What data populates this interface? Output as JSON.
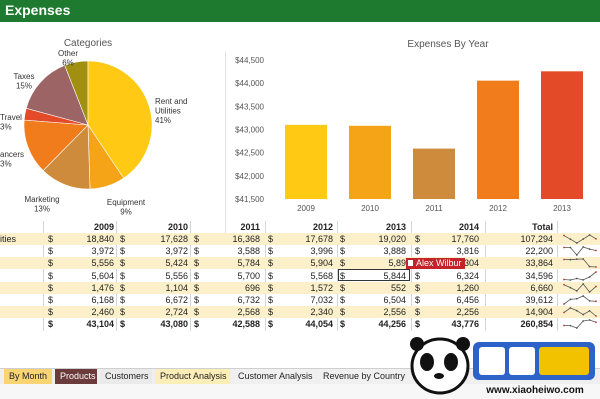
{
  "window": {
    "title": "Expenses"
  },
  "chart_data": [
    {
      "type": "pie",
      "title": "Categories",
      "slices": [
        {
          "label": "Other",
          "value": 6,
          "color": "#a08f10"
        },
        {
          "label": "Rent and Utilities",
          "value": 41,
          "color": "#ffc914"
        },
        {
          "label": "Equipment",
          "value": 9,
          "color": "#f5a418"
        },
        {
          "label": "Marketing",
          "value": 13,
          "color": "#cf8b3c"
        },
        {
          "label": "Freelancers",
          "value": 14,
          "color": "#f07c1c"
        },
        {
          "label": "Travel",
          "value": 3,
          "color": "#e34b28"
        },
        {
          "label": "Taxes",
          "value": 15,
          "color": "#9c6464"
        }
      ],
      "labels_text": {
        "other": [
          "Other",
          "6%"
        ],
        "rent": [
          "Rent and",
          "Utilities",
          "41%"
        ],
        "equipment": [
          "Equipment",
          "9%"
        ],
        "marketing": [
          "Marketing",
          "13%"
        ],
        "freelancers": [
          "ancers",
          "3%"
        ],
        "travel": [
          "Travel",
          "3%"
        ],
        "taxes": [
          "Taxes",
          "15%"
        ]
      }
    },
    {
      "type": "bar",
      "title": "Expenses By Year",
      "categories": [
        "2009",
        "2010",
        "2011",
        "2012",
        "2013"
      ],
      "values": [
        43100,
        43080,
        42588,
        44054,
        44256
      ],
      "colors": [
        "#ffc914",
        "#f5a418",
        "#cf8b3c",
        "#f07c1c",
        "#e34b28"
      ],
      "ylim": [
        41500,
        44500
      ],
      "yticks": [
        "$44,500",
        "$44,000",
        "$43,500",
        "$43,000",
        "$42,500",
        "$42,000",
        "$41,500"
      ],
      "ytick_values": [
        44500,
        44000,
        43500,
        43000,
        42500,
        42000,
        41500
      ],
      "grid": false
    }
  ],
  "table": {
    "headers": [
      "2009",
      "2010",
      "2011",
      "2012",
      "2013",
      "2014",
      "Total"
    ],
    "rows": [
      {
        "label": "ities",
        "cells": [
          "18,840",
          "17,628",
          "16,368",
          "17,678",
          "19,020",
          "17,760",
          "107,294"
        ]
      },
      {
        "label": "",
        "cells": [
          "3,972",
          "3,972",
          "3,588",
          "3,996",
          "3,888",
          "3,816",
          "22,200"
        ]
      },
      {
        "label": "",
        "cells": [
          "5,556",
          "5,424",
          "5,784",
          "5,904",
          "5,89",
          ",304",
          "33,864"
        ]
      },
      {
        "label": "",
        "cells": [
          "5,604",
          "5,556",
          "5,700",
          "5,568",
          "5,844",
          "6,324",
          "34,596"
        ]
      },
      {
        "label": "",
        "cells": [
          "1,476",
          "1,104",
          "696",
          "1,572",
          "552",
          "1,260",
          "6,660"
        ]
      },
      {
        "label": "",
        "cells": [
          "6,168",
          "6,672",
          "6,732",
          "7,032",
          "6,504",
          "6,456",
          "39,612"
        ]
      },
      {
        "label": "",
        "cells": [
          "2,460",
          "2,724",
          "2,568",
          "2,340",
          "2,556",
          "2,256",
          "14,904"
        ]
      },
      {
        "label": "",
        "cells": [
          "43,104",
          "43,080",
          "42,588",
          "44,054",
          "44,256",
          "43,776",
          "260,854"
        ],
        "bold": true
      }
    ],
    "currency": "$",
    "tooltip": "Alex Wilbur"
  },
  "tabs": [
    {
      "label": "By Month",
      "color": "#f8d473"
    },
    {
      "label": "Products",
      "color": "#6b3a3a"
    },
    {
      "label": "Customers",
      "color": "#eaeaea"
    },
    {
      "label": "Product Analysis",
      "color": "#fbeeb8"
    },
    {
      "label": "Customer Analysis",
      "color": "#f0f0f0"
    },
    {
      "label": "Revenue by Country",
      "color": "#f0f0f0"
    }
  ],
  "watermark": {
    "text": "www.xiaoheiwo.com"
  }
}
